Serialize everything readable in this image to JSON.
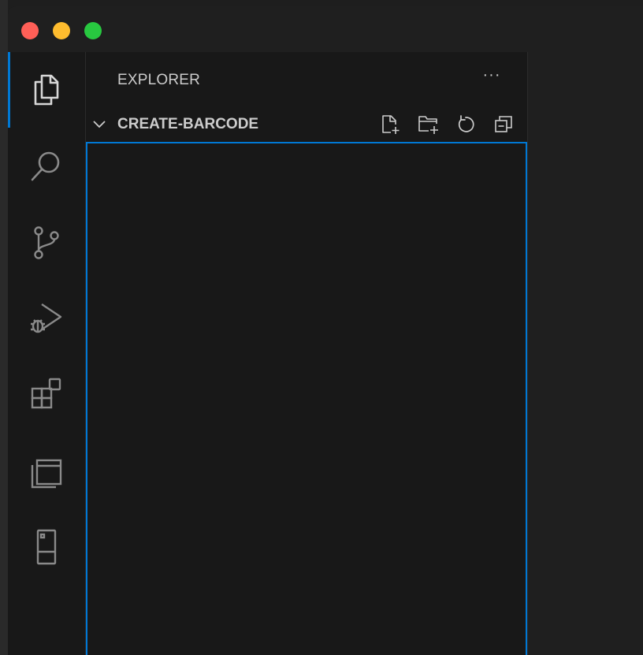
{
  "window": {
    "traffic_lights": {
      "close_color": "#ff5f57",
      "minimize_color": "#febc2e",
      "zoom_color": "#28c840"
    }
  },
  "activity_bar": {
    "items": [
      {
        "name": "explorer",
        "icon": "files-icon",
        "active": true
      },
      {
        "name": "search",
        "icon": "search-icon",
        "active": false
      },
      {
        "name": "source-control",
        "icon": "source-control-icon",
        "active": false
      },
      {
        "name": "run-and-debug",
        "icon": "run-debug-icon",
        "active": false
      },
      {
        "name": "extensions",
        "icon": "extensions-icon",
        "active": false
      },
      {
        "name": "remote-explorer",
        "icon": "remote-explorer-icon",
        "active": false
      },
      {
        "name": "devices",
        "icon": "device-icon",
        "active": false
      }
    ],
    "accent_color": "#0078d4"
  },
  "sidebar": {
    "title": "EXPLORER",
    "more_actions_label": "···",
    "section": {
      "title": "CREATE-BARCODE",
      "expanded": true,
      "actions": [
        {
          "name": "new-file",
          "icon": "new-file-icon"
        },
        {
          "name": "new-folder",
          "icon": "new-folder-icon"
        },
        {
          "name": "refresh",
          "icon": "refresh-icon"
        },
        {
          "name": "collapse-all",
          "icon": "collapse-all-icon"
        }
      ]
    },
    "focus_border_color": "#0078d4"
  }
}
